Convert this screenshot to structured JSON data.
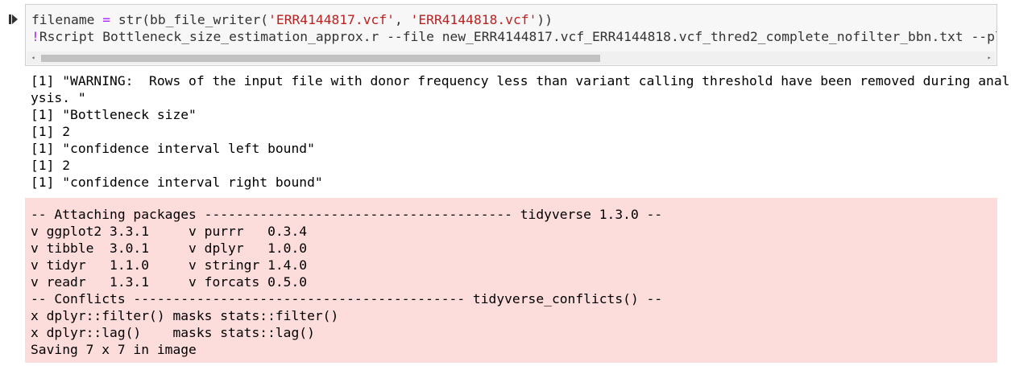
{
  "cell": {
    "code_line1": {
      "a": "filename ",
      "op": "=",
      "b": " str(bb_file_writer(",
      "s1": "'ERR4144817.vcf'",
      "c": ", ",
      "s2": "'ERR4144818.vcf'",
      "d": "))"
    },
    "code_line2": {
      "bang": "!",
      "rest": "Rscript Bottleneck_size_estimation_approx.r --file new_ERR4144817.vcf_ERR4144818.vcf_thred2_complete_nofilter_bbn.txt --plot"
    },
    "scroll_left": "◂",
    "scroll_right": "▸"
  },
  "stdout_lines": [
    "[1] \"WARNING:  Rows of the input file with donor frequency less than variant calling threshold have been removed during anal",
    "ysis. \"",
    "[1] \"Bottleneck size\"",
    "[1] 2",
    "[1] \"confidence interval left bound\"",
    "[1] 2",
    "[1] \"confidence interval right bound\""
  ],
  "stderr_lines": [
    "-- Attaching packages --------------------------------------- tidyverse 1.3.0 --",
    "v ggplot2 3.3.1     v purrr   0.3.4",
    "v tibble  3.0.1     v dplyr   1.0.0",
    "v tidyr   1.1.0     v stringr 1.4.0",
    "v readr   1.3.1     v forcats 0.5.0",
    "-- Conflicts ------------------------------------------ tidyverse_conflicts() --",
    "x dplyr::filter() masks stats::filter()",
    "x dplyr::lag()    masks stats::lag()",
    "Saving 7 x 7 in image"
  ]
}
